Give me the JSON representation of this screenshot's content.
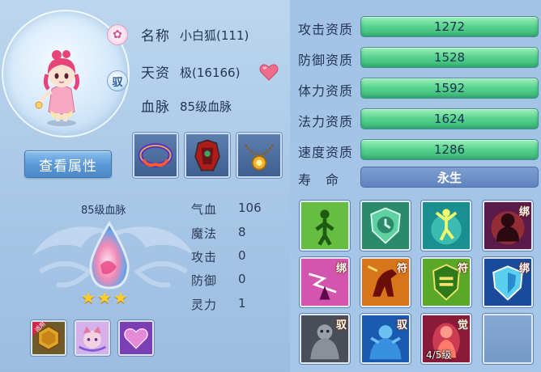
{
  "pet": {
    "name_label": "名称",
    "name_value": "小白狐(111)",
    "talent_label": "天资",
    "talent_value": "极(16166)",
    "bloodline_label": "血脉",
    "bloodline_value": "85级血脉",
    "tamed_badge": "驭",
    "view_attributes_button": "查看属性"
  },
  "bloodline": {
    "title": "85级血脉",
    "stars": 3,
    "star_glyph": "★"
  },
  "stats": [
    {
      "label": "气血",
      "value": "106"
    },
    {
      "label": "魔法",
      "value": "8"
    },
    {
      "label": "攻击",
      "value": "0"
    },
    {
      "label": "防御",
      "value": "0"
    },
    {
      "label": "灵力",
      "value": "1"
    }
  ],
  "aptitudes": [
    {
      "label": "攻击资质",
      "value": "1272"
    },
    {
      "label": "防御资质",
      "value": "1528"
    },
    {
      "label": "体力资质",
      "value": "1592"
    },
    {
      "label": "法力资质",
      "value": "1624"
    },
    {
      "label": "速度资质",
      "value": "1286"
    }
  ],
  "lifespan": {
    "label": "寿　命",
    "value": "永生"
  },
  "bottom_items": [
    {
      "icon": "hexagon-gold-icon",
      "badge": "适用"
    },
    {
      "icon": "pet-face-icon"
    },
    {
      "icon": "heart-purple-icon"
    }
  ],
  "equipment": [
    {
      "icon": "bracelet-icon"
    },
    {
      "icon": "armor-icon"
    },
    {
      "icon": "necklace-icon"
    }
  ],
  "skills": [
    {
      "icon": "green-figure-icon",
      "tag": "",
      "level": ""
    },
    {
      "icon": "green-shield-clock-icon",
      "tag": "",
      "level": ""
    },
    {
      "icon": "cyan-dancer-icon",
      "tag": "",
      "level": ""
    },
    {
      "icon": "dark-ogre-icon",
      "tag": "绑",
      "level": ""
    },
    {
      "icon": "pink-lightning-icon",
      "tag": "绑",
      "level": ""
    },
    {
      "icon": "red-horse-icon",
      "tag": "符",
      "level": ""
    },
    {
      "icon": "green-badge-icon",
      "tag": "符",
      "level": ""
    },
    {
      "icon": "blue-shield-icon",
      "tag": "绑",
      "level": ""
    },
    {
      "icon": "stone-golem-icon",
      "tag": "驭",
      "level": ""
    },
    {
      "icon": "blue-warrior-icon",
      "tag": "驭",
      "level": ""
    },
    {
      "icon": "red-spirit-icon",
      "tag": "觉",
      "level": "4/5级"
    },
    {
      "icon": "empty-slot-icon",
      "tag": "",
      "level": ""
    }
  ],
  "colors": {
    "background": "#a8c6e6",
    "aptitude_bar": "#55d28d",
    "life_bar": "#5e83bf",
    "button": "#5d9ad8",
    "star": "#ffcd2a"
  }
}
